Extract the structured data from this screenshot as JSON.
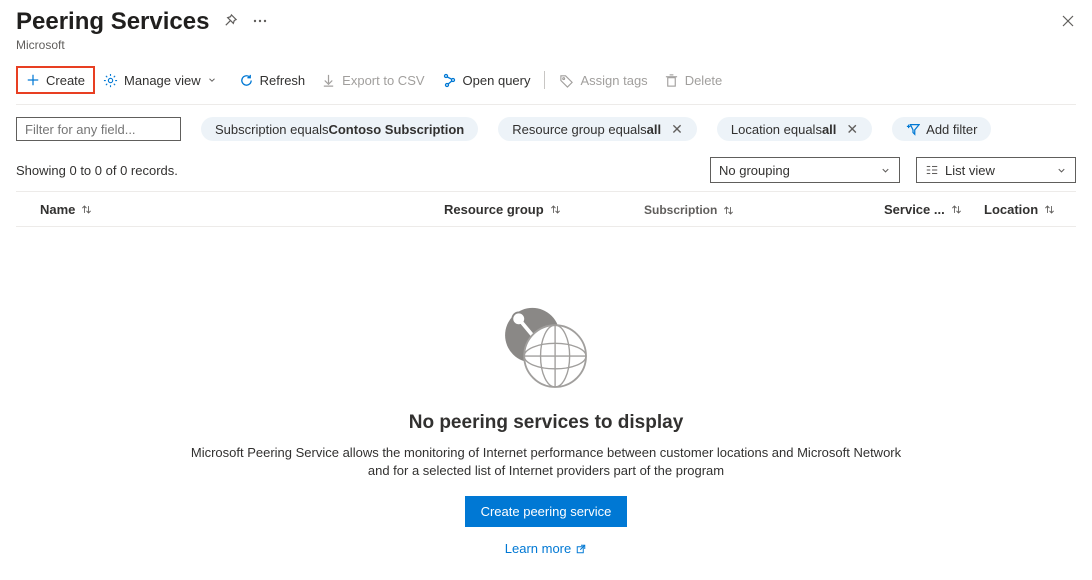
{
  "header": {
    "title": "Peering Services",
    "subtitle": "Microsoft"
  },
  "toolbar": {
    "create": "Create",
    "manage_view": "Manage view",
    "refresh": "Refresh",
    "export_csv": "Export to CSV",
    "open_query": "Open query",
    "assign_tags": "Assign tags",
    "delete": "Delete"
  },
  "filter": {
    "placeholder": "Filter for any field...",
    "pills": {
      "subscription_prefix": "Subscription equals ",
      "subscription_value": "Contoso Subscription",
      "rg_prefix": "Resource group equals ",
      "rg_value": "all",
      "loc_prefix": "Location equals ",
      "loc_value": "all"
    },
    "add_filter": "Add filter"
  },
  "controls": {
    "count": "Showing 0 to 0 of 0 records.",
    "grouping": "No grouping",
    "view": "List view"
  },
  "columns": {
    "name": "Name",
    "rg": "Resource group",
    "sub": "Subscription",
    "svc": "Service ...",
    "loc": "Location"
  },
  "empty": {
    "title": "No peering services to display",
    "desc": "Microsoft Peering Service allows the monitoring of Internet performance between customer locations and Microsoft Network and for a selected list of Internet providers part of the program",
    "primary": "Create peering service",
    "learn": "Learn more"
  }
}
